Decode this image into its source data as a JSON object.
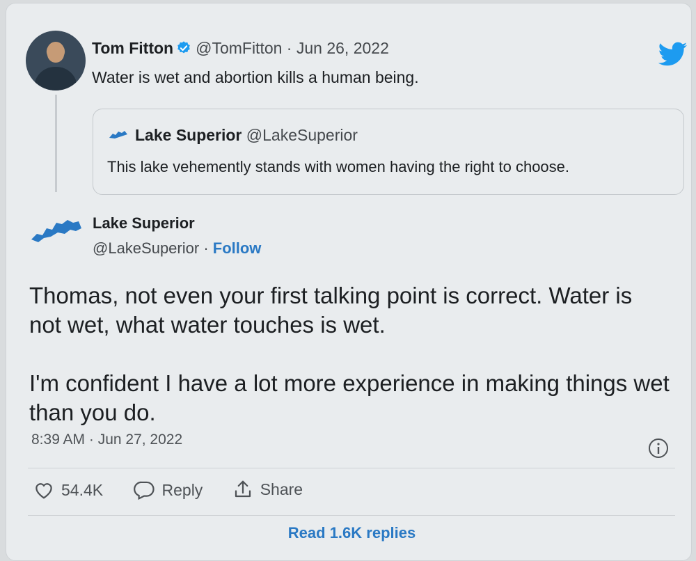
{
  "tweet": {
    "author_name": "Tom Fitton",
    "author_meta": "@TomFitton · Jun 26, 2022",
    "text": "Water is wet and abortion kills a human being."
  },
  "quote": {
    "name": "Lake Superior",
    "handle": "@LakeSuperior",
    "text": "This lake vehemently stands with women having the right to choose."
  },
  "reply": {
    "name": "Lake Superior",
    "handle": "@LakeSuperior",
    "separator": " · ",
    "follow_label": "Follow",
    "paragraph1": "Thomas, not even your first talking point is correct. Water is not wet, what water touches is wet.",
    "paragraph2": "I'm confident I have a lot more experience in making things wet than you do.",
    "timestamp": "8:39 AM · Jun 27, 2022"
  },
  "actions": {
    "likes": "54.4K",
    "reply_label": "Reply",
    "share_label": "Share"
  },
  "footer": {
    "read_replies": "Read 1.6K replies"
  },
  "colors": {
    "accent": "#2a79c4",
    "twitter_blue": "#1d9bf0",
    "text": "#1c1f22",
    "muted": "#4e5256"
  },
  "icons": [
    "verified-badge-icon",
    "twitter-bird-icon",
    "lake-logo-icon",
    "info-icon",
    "heart-icon",
    "reply-bubble-icon",
    "share-icon"
  ]
}
